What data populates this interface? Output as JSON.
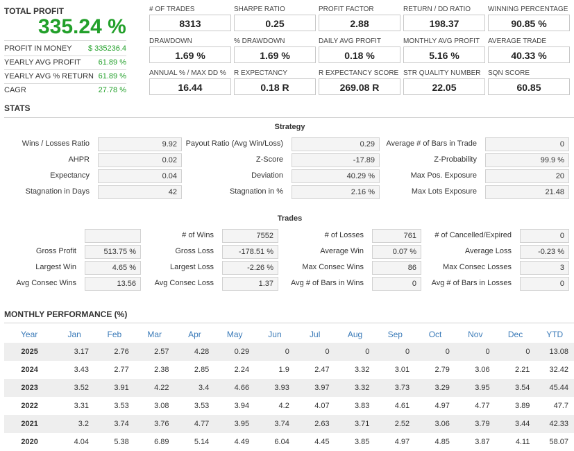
{
  "summary": {
    "total_profit_label": "TOTAL PROFIT",
    "total_profit_value": "335.24 %",
    "rows": [
      {
        "label": "PROFIT IN MONEY",
        "value": "$ 335236.4"
      },
      {
        "label": "YEARLY AVG PROFIT",
        "value": "61.89 %"
      },
      {
        "label": "YEARLY AVG % RETURN",
        "value": "61.89 %"
      },
      {
        "label": "CAGR",
        "value": "27.78 %"
      }
    ]
  },
  "metrics": [
    [
      {
        "label": "# OF TRADES",
        "value": "8313"
      },
      {
        "label": "SHARPE RATIO",
        "value": "0.25"
      },
      {
        "label": "PROFIT FACTOR",
        "value": "2.88"
      },
      {
        "label": "RETURN / DD RATIO",
        "value": "198.37"
      },
      {
        "label": "WINNING PERCENTAGE",
        "value": "90.85 %"
      }
    ],
    [
      {
        "label": "DRAWDOWN",
        "value": "1.69 %"
      },
      {
        "label": "% DRAWDOWN",
        "value": "1.69 %"
      },
      {
        "label": "DAILY AVG PROFIT",
        "value": "0.18 %"
      },
      {
        "label": "MONTHLY AVG PROFIT",
        "value": "5.16 %"
      },
      {
        "label": "AVERAGE TRADE",
        "value": "40.33 %"
      }
    ],
    [
      {
        "label": "ANNUAL % / MAX DD %",
        "value": "16.44"
      },
      {
        "label": "R EXPECTANCY",
        "value": "0.18 R"
      },
      {
        "label": "R EXPECTANCY SCORE",
        "value": "269.08 R"
      },
      {
        "label": "STR QUALITY NUMBER",
        "value": "22.05"
      },
      {
        "label": "SQN SCORE",
        "value": "60.85"
      }
    ]
  ],
  "stats": {
    "title": "STATS",
    "strategy": {
      "title": "Strategy",
      "rows": [
        [
          {
            "label": "Wins / Losses Ratio",
            "value": "9.92"
          },
          {
            "label": "Payout Ratio (Avg Win/Loss)",
            "value": "0.29"
          },
          {
            "label": "Average # of Bars in Trade",
            "value": "0"
          }
        ],
        [
          {
            "label": "AHPR",
            "value": "0.02"
          },
          {
            "label": "Z-Score",
            "value": "-17.89"
          },
          {
            "label": "Z-Probability",
            "value": "99.9 %"
          }
        ],
        [
          {
            "label": "Expectancy",
            "value": "0.04"
          },
          {
            "label": "Deviation",
            "value": "40.29 %"
          },
          {
            "label": "Max Pos. Exposure",
            "value": "20"
          }
        ],
        [
          {
            "label": "Stagnation in Days",
            "value": "42"
          },
          {
            "label": "Stagnation in %",
            "value": "2.16 %"
          },
          {
            "label": "Max Lots Exposure",
            "value": "21.48"
          }
        ]
      ]
    },
    "trades": {
      "title": "Trades",
      "rows": [
        [
          {
            "label": "",
            "value": ""
          },
          {
            "label": "# of Wins",
            "value": "7552"
          },
          {
            "label": "# of Losses",
            "value": "761"
          },
          {
            "label": "# of Cancelled/Expired",
            "value": "0"
          }
        ],
        [
          {
            "label": "Gross Profit",
            "value": "513.75 %"
          },
          {
            "label": "Gross Loss",
            "value": "-178.51 %"
          },
          {
            "label": "Average Win",
            "value": "0.07 %"
          },
          {
            "label": "Average Loss",
            "value": "-0.23 %"
          }
        ],
        [
          {
            "label": "Largest Win",
            "value": "4.65 %"
          },
          {
            "label": "Largest Loss",
            "value": "-2.26 %"
          },
          {
            "label": "Max Consec Wins",
            "value": "86"
          },
          {
            "label": "Max Consec Losses",
            "value": "3"
          }
        ],
        [
          {
            "label": "Avg Consec Wins",
            "value": "13.56"
          },
          {
            "label": "Avg Consec Loss",
            "value": "1.37"
          },
          {
            "label": "Avg # of Bars in Wins",
            "value": "0"
          },
          {
            "label": "Avg # of Bars in Losses",
            "value": "0"
          }
        ]
      ]
    }
  },
  "monthly": {
    "title": "MONTHLY PERFORMANCE (%)",
    "headers": [
      "Year",
      "Jan",
      "Feb",
      "Mar",
      "Apr",
      "May",
      "Jun",
      "Jul",
      "Aug",
      "Sep",
      "Oct",
      "Nov",
      "Dec",
      "YTD"
    ],
    "rows": [
      [
        "2025",
        "3.17",
        "2.76",
        "2.57",
        "4.28",
        "0.29",
        "0",
        "0",
        "0",
        "0",
        "0",
        "0",
        "0",
        "13.08"
      ],
      [
        "2024",
        "3.43",
        "2.77",
        "2.38",
        "2.85",
        "2.24",
        "1.9",
        "2.47",
        "3.32",
        "3.01",
        "2.79",
        "3.06",
        "2.21",
        "32.42"
      ],
      [
        "2023",
        "3.52",
        "3.91",
        "4.22",
        "3.4",
        "4.66",
        "3.93",
        "3.97",
        "3.32",
        "3.73",
        "3.29",
        "3.95",
        "3.54",
        "45.44"
      ],
      [
        "2022",
        "3.31",
        "3.53",
        "3.08",
        "3.53",
        "3.94",
        "4.2",
        "4.07",
        "3.83",
        "4.61",
        "4.97",
        "4.77",
        "3.89",
        "47.7"
      ],
      [
        "2021",
        "3.2",
        "3.74",
        "3.76",
        "4.77",
        "3.95",
        "3.74",
        "2.63",
        "3.71",
        "2.52",
        "3.06",
        "3.79",
        "3.44",
        "42.33"
      ],
      [
        "2020",
        "4.04",
        "5.38",
        "6.89",
        "5.14",
        "4.49",
        "6.04",
        "4.45",
        "3.85",
        "4.97",
        "4.85",
        "3.87",
        "4.11",
        "58.07"
      ]
    ]
  }
}
